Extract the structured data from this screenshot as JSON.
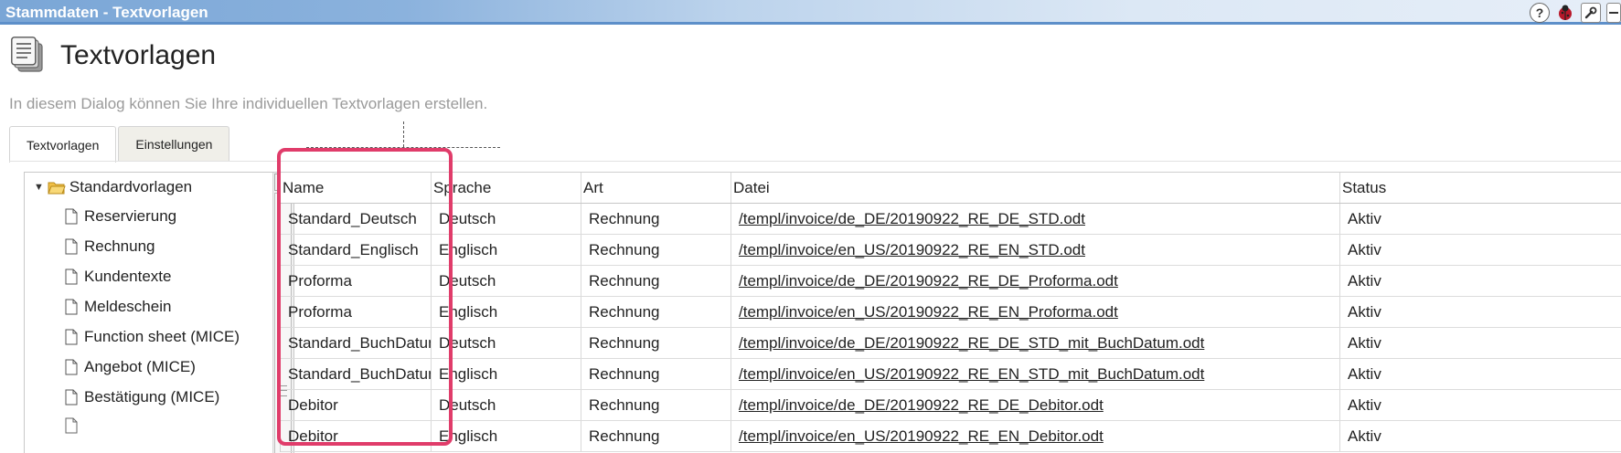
{
  "window": {
    "title": "Stammdaten - Textvorlagen"
  },
  "titlebar_icons": [
    "help-icon",
    "bug-icon",
    "wrench-icon",
    "minimize-icon"
  ],
  "header": {
    "title": "Textvorlagen",
    "subtitle": "In diesem Dialog können Sie Ihre individuellen Textvorlagen erstellen."
  },
  "tabs": [
    {
      "label": "Textvorlagen",
      "active": true
    },
    {
      "label": "Einstellungen",
      "active": false
    }
  ],
  "tree": {
    "root": {
      "label": "Standardvorlagen",
      "expanded": true
    },
    "items": [
      {
        "label": "Reservierung"
      },
      {
        "label": "Rechnung"
      },
      {
        "label": "Kundentexte"
      },
      {
        "label": "Meldeschein"
      },
      {
        "label": "Function sheet (MICE)"
      },
      {
        "label": "Angebot (MICE)"
      },
      {
        "label": "Bestätigung (MICE)"
      }
    ]
  },
  "grid": {
    "columns": [
      "Name",
      "Sprache",
      "Art",
      "Datei",
      "Status"
    ],
    "rows": [
      {
        "name": "Standard_Deutsch",
        "lang": "Deutsch",
        "art": "Rechnung",
        "file": "/templ/invoice/de_DE/20190922_RE_DE_STD.odt",
        "status": "Aktiv"
      },
      {
        "name": "Standard_Englisch",
        "lang": "Englisch",
        "art": "Rechnung",
        "file": "/templ/invoice/en_US/20190922_RE_EN_STD.odt",
        "status": "Aktiv"
      },
      {
        "name": "Proforma",
        "lang": "Deutsch",
        "art": "Rechnung",
        "file": "/templ/invoice/de_DE/20190922_RE_DE_Proforma.odt",
        "status": "Aktiv"
      },
      {
        "name": "Proforma",
        "lang": "Englisch",
        "art": "Rechnung",
        "file": "/templ/invoice/en_US/20190922_RE_EN_Proforma.odt",
        "status": "Aktiv"
      },
      {
        "name": "Standard_BuchDatum",
        "lang": "Deutsch",
        "art": "Rechnung",
        "file": "/templ/invoice/de_DE/20190922_RE_DE_STD_mit_BuchDatum.odt",
        "status": "Aktiv"
      },
      {
        "name": "Standard_BuchDatum",
        "lang": "Englisch",
        "art": "Rechnung",
        "file": "/templ/invoice/en_US/20190922_RE_EN_STD_mit_BuchDatum.odt",
        "status": "Aktiv"
      },
      {
        "name": "Debitor",
        "lang": "Deutsch",
        "art": "Rechnung",
        "file": "/templ/invoice/de_DE/20190922_RE_DE_Debitor.odt",
        "status": "Aktiv"
      },
      {
        "name": "Debitor",
        "lang": "Englisch",
        "art": "Rechnung",
        "file": "/templ/invoice/en_US/20190922_RE_EN_Debitor.odt",
        "status": "Aktiv"
      }
    ]
  },
  "colors": {
    "titlebar": "#7aa6d6",
    "highlight": "#e03c6a",
    "subtitle": "#9a9a9a"
  }
}
